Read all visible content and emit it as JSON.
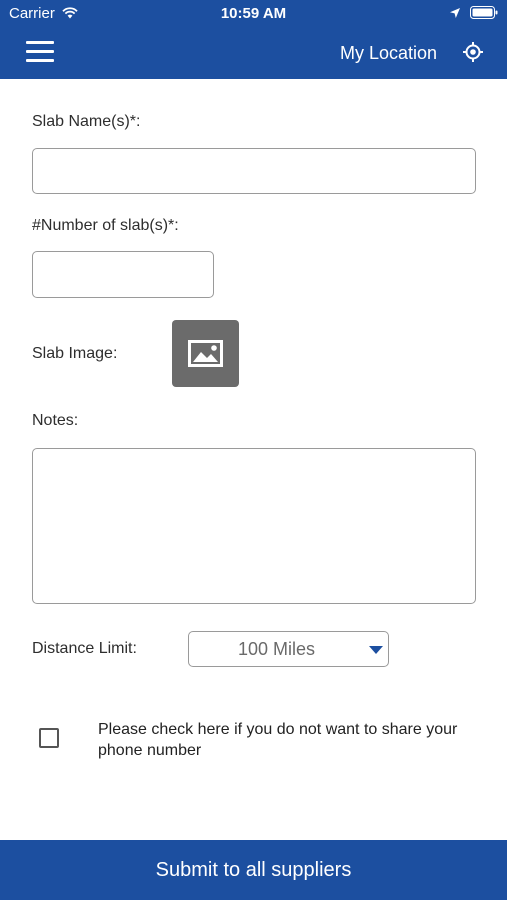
{
  "status_bar": {
    "carrier": "Carrier",
    "time": "10:59 AM",
    "icons": [
      "wifi-icon",
      "location-arrow-icon",
      "battery-icon"
    ]
  },
  "header": {
    "menu_icon": "hamburger-menu-icon",
    "my_location_label": "My Location",
    "location_icon": "target-location-icon",
    "background_color": "#1c4fa0"
  },
  "form": {
    "slab_name_label": "Slab Name(s)*:",
    "slab_name_value": "",
    "slab_count_label": "#Number of slab(s)*:",
    "slab_count_value": "",
    "slab_image_label": "Slab Image:",
    "slab_image_icon": "image-icon",
    "notes_label": "Notes:",
    "notes_value": "",
    "distance_label": "Distance Limit:",
    "distance_value": "100 Miles",
    "phone_checkbox_text": "Please check here if you do not want to share your phone number",
    "phone_checkbox_checked": false
  },
  "submit": {
    "label": "Submit to all suppliers"
  }
}
